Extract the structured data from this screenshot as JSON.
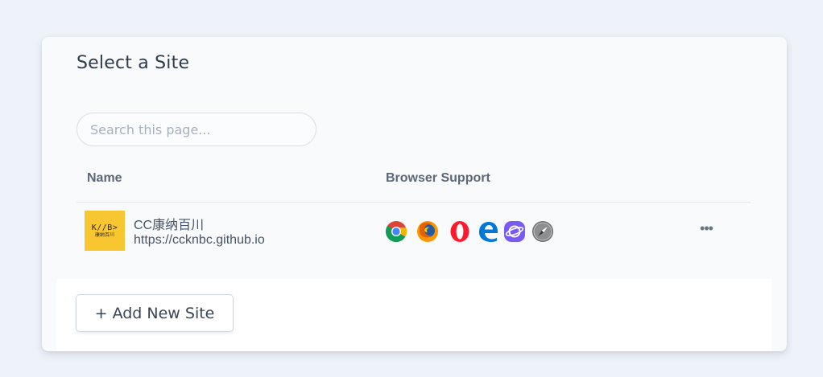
{
  "page": {
    "title": "Select a Site",
    "search_placeholder": "Search this page..."
  },
  "table": {
    "columns": [
      "Name",
      "Browser Support"
    ],
    "rows": [
      {
        "thumbnail_text_top": "K//B>",
        "thumbnail_text_bottom": "康纳百川",
        "name": "CC康纳百川",
        "url": "https://ccknbc.github.io",
        "browsers": [
          "chrome-icon",
          "firefox-icon",
          "opera-icon",
          "edge-icon",
          "samsung-internet-icon",
          "safari-icon"
        ],
        "menu_label": "•••"
      }
    ]
  },
  "footer": {
    "add_button_label": "+ Add New Site"
  },
  "colors": {
    "background": "#eef2f9",
    "card": "#f8fafc",
    "thumbnail": "#f7c631",
    "text": "#2f3a4d"
  }
}
